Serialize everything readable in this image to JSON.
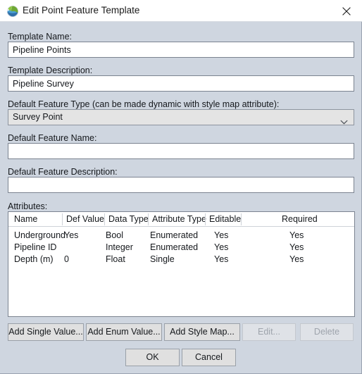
{
  "window": {
    "title": "Edit Point Feature Template",
    "icon": "globe-icon",
    "close_label": "✕"
  },
  "form": {
    "template_name": {
      "label": "Template Name:",
      "value": "Pipeline Points",
      "placeholder": ""
    },
    "template_description": {
      "label": "Template Description:",
      "value": "Pipeline Survey",
      "placeholder": ""
    },
    "default_feature_type": {
      "label": "Default Feature Type (can be made dynamic with style map attribute):",
      "value": "Survey Point",
      "options": [
        "Survey Point"
      ]
    },
    "default_feature_name": {
      "label": "Default Feature Name:",
      "value": "",
      "placeholder": ""
    },
    "default_feature_description": {
      "label": "Default Feature Description:",
      "value": "",
      "placeholder": ""
    }
  },
  "attributes": {
    "label": "Attributes:",
    "columns": [
      "Name",
      "Def Value",
      "Data Type",
      "Attribute Type",
      "Editable",
      "Required"
    ],
    "rows": [
      {
        "name": "Underground",
        "def_value": "Yes",
        "data_type": "Bool",
        "attribute_type": "Enumerated",
        "editable": "Yes",
        "required": "Yes"
      },
      {
        "name": "Pipeline ID",
        "def_value": "",
        "data_type": "Integer",
        "attribute_type": "Enumerated",
        "editable": "Yes",
        "required": "Yes"
      },
      {
        "name": "Depth (m)",
        "def_value": "0",
        "data_type": "Float",
        "attribute_type": "Single",
        "editable": "Yes",
        "required": "Yes"
      }
    ]
  },
  "toolbar": {
    "add_single_value": "Add Single Value...",
    "add_enum_value": "Add Enum Value...",
    "add_style_map": "Add Style Map...",
    "edit": "Edit...",
    "delete": "Delete"
  },
  "footer": {
    "ok": "OK",
    "cancel": "Cancel"
  },
  "colors": {
    "dialog_background": "#cfd6e0",
    "titlebar_background": "#ffffff",
    "input_background": "#ffffff",
    "combo_background": "#e4e4e4",
    "button_background": "#e0e0e0",
    "text": "#15181c",
    "disabled_text": "#9ea4ac"
  }
}
